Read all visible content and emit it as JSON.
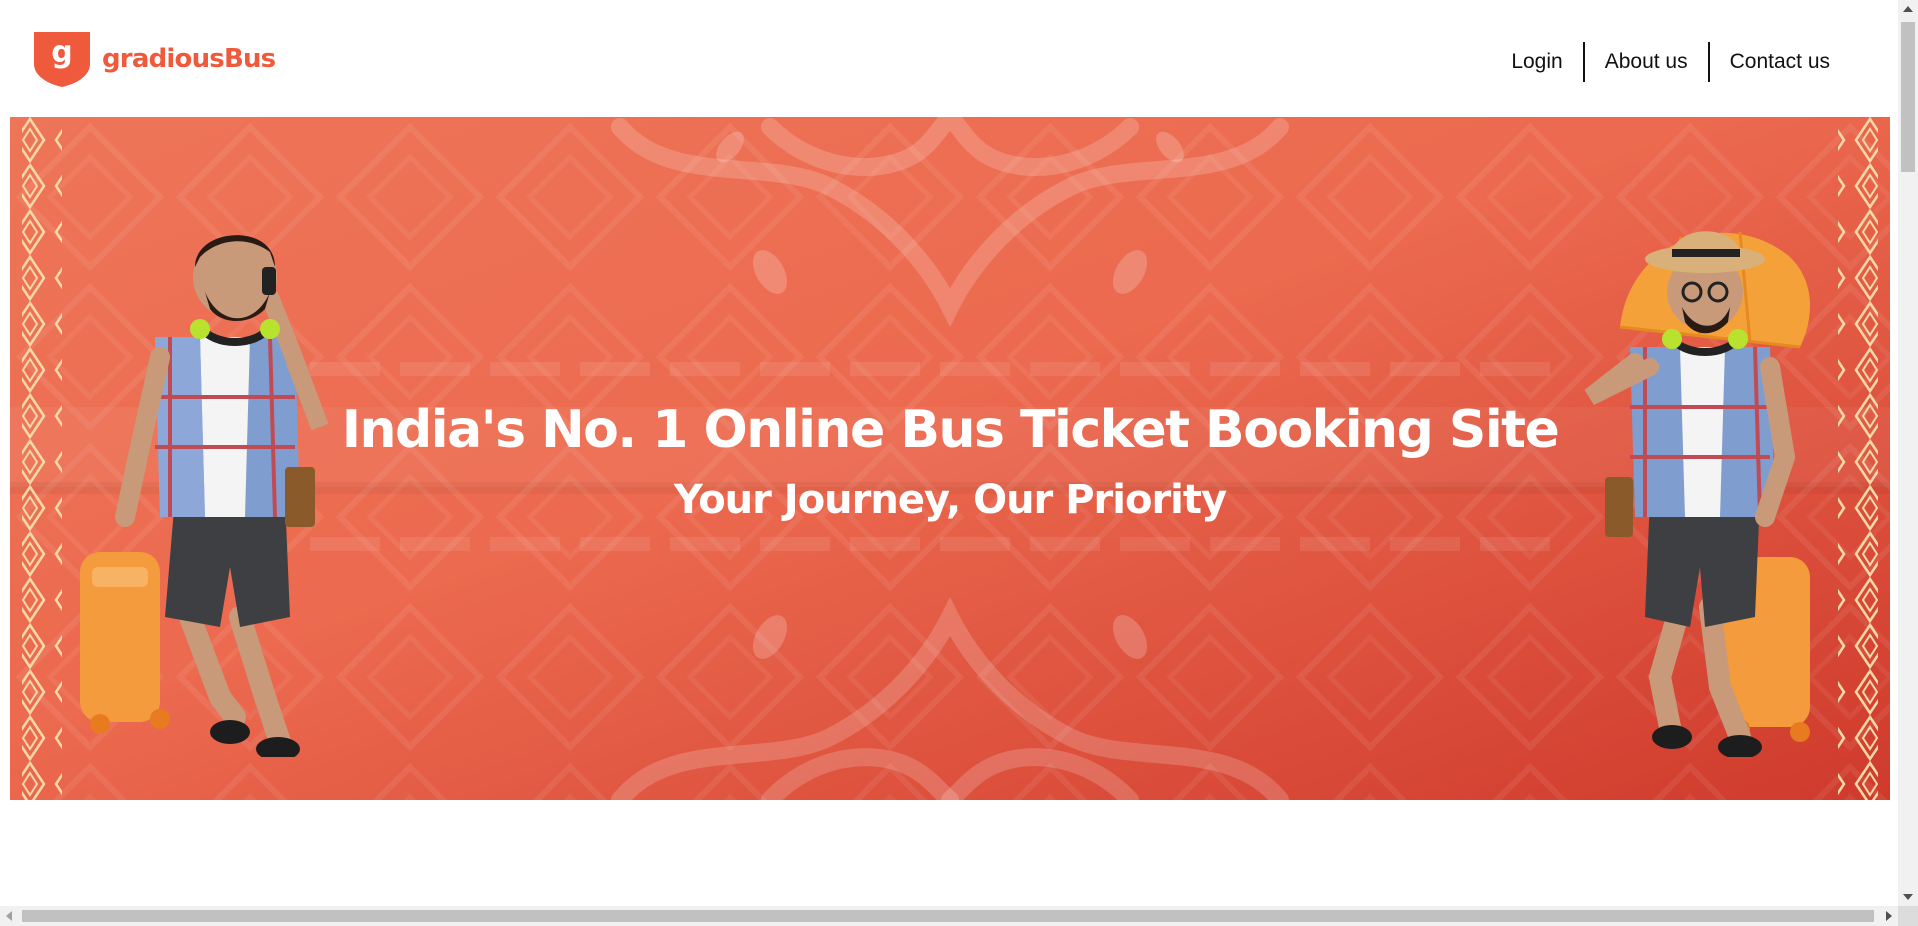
{
  "brand": {
    "name": "gradiousBus",
    "logo_letter": "g",
    "color": "#ef5a3c"
  },
  "nav": {
    "items": [
      {
        "label": "Login"
      },
      {
        "label": "About us"
      },
      {
        "label": "Contact us"
      }
    ]
  },
  "hero": {
    "title": "India's No. 1 Online Bus Ticket Booking Site",
    "subtitle": "Your Journey, Our Priority",
    "background_color": "#e85a40",
    "left_image": "traveler-on-phone-with-suitcase",
    "right_image": "traveler-with-umbrella-and-suitcase"
  }
}
